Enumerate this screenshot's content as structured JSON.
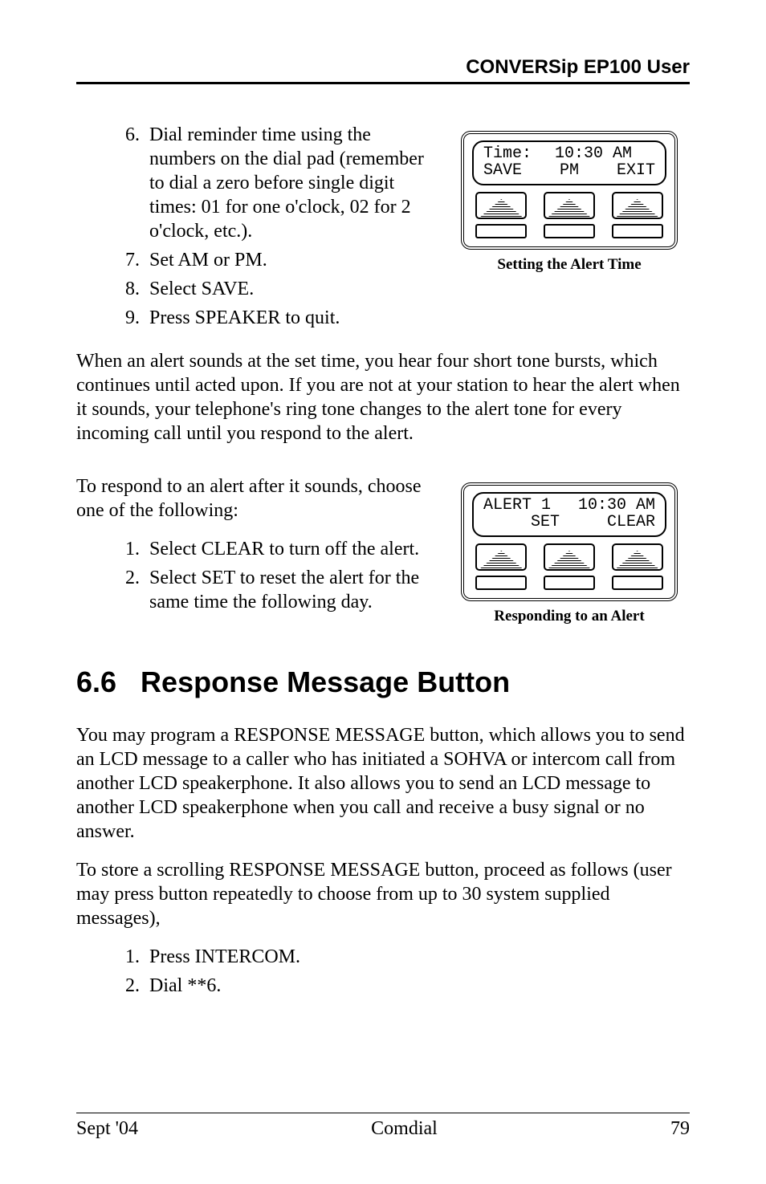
{
  "header": {
    "title": "CONVERSip EP100 User"
  },
  "list1": {
    "start": 6,
    "items": [
      "Dial reminder time using the numbers on the dial pad (remember to dial a zero before single digit times: 01 for one o'clock, 02 for 2 o'clock, etc.).",
      "Set AM or PM.",
      "Select SAVE.",
      "Press SPEAKER to quit."
    ]
  },
  "fig1": {
    "line1_left": "Time:",
    "line1_right": "10:30 AM",
    "line2_left": "SAVE",
    "line2_mid": "PM",
    "line2_right": "EXIT",
    "caption": "Setting the Alert Time"
  },
  "para1": "When an alert sounds at the set time, you hear four short tone bursts, which continues until acted upon.  If you are not at your station to hear the alert when it sounds, your telephone's ring tone changes to the alert tone for every incoming call until you respond to the alert.",
  "para2": "To respond to an alert after it sounds, choose one of the following:",
  "list2": {
    "start": 1,
    "items": [
      "Select CLEAR to turn off the alert.",
      "Select SET to reset the alert for the same time the following day."
    ]
  },
  "fig2": {
    "line1_left": "ALERT 1",
    "line1_right": "10:30 AM",
    "line2_mid": "SET",
    "line2_right": "CLEAR",
    "caption": "Responding to an Alert"
  },
  "section": {
    "num": "6.6",
    "title": "Response Message Button"
  },
  "para3": "You may program a RESPONSE MESSAGE button, which allows you to send an LCD message to a caller who has initiated a SOHVA or intercom call from another LCD speakerphone.  It also allows you to send an LCD message to another LCD speakerphone when you call and receive a busy signal or no answer.",
  "para4": "To store a scrolling RESPONSE MESSAGE button, proceed as follows (user may press button repeatedly to choose from up to 30 system supplied messages),",
  "list3": {
    "start": 1,
    "items": [
      "Press INTERCOM.",
      "Dial **6."
    ]
  },
  "footer": {
    "left": "Sept '04",
    "center": "Comdial",
    "right": "79"
  }
}
